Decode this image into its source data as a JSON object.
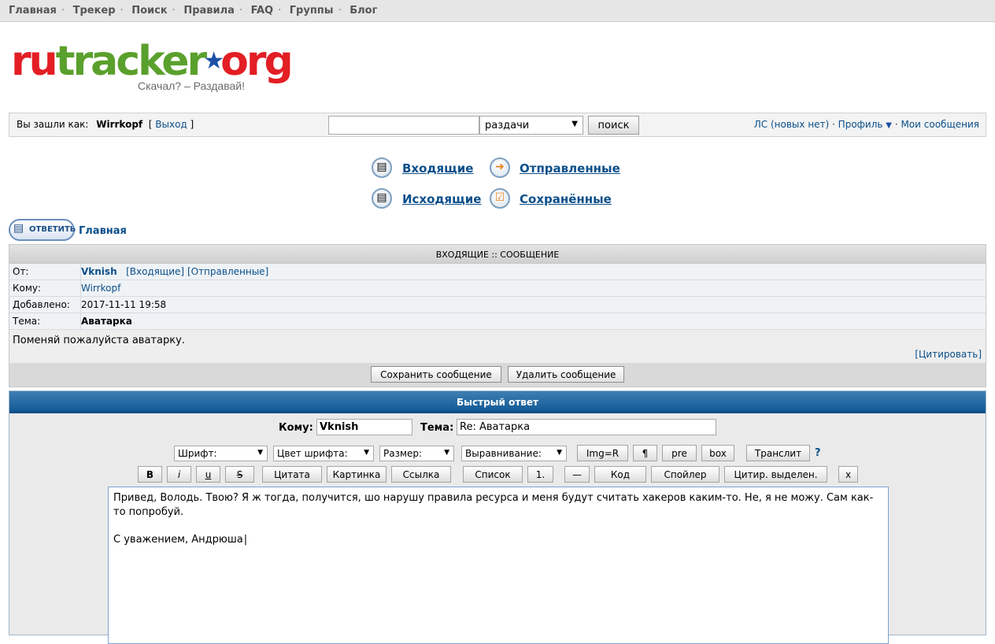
{
  "topnav": [
    "Главная",
    "Трекер",
    "Поиск",
    "Правила",
    "FAQ",
    "Группы",
    "Блог"
  ],
  "logo": {
    "ru": "ru",
    "tracker": "tracker",
    "org": "org",
    "slogan": "Скачал? – Раздавай!"
  },
  "userbar": {
    "logged_as": "Вы зашли как:",
    "username": "Wirrkopf",
    "logout": "Выход",
    "search_scope": "раздачи",
    "search_button": "поиск",
    "pm_link": "ЛС (новых нет)",
    "profile": "Профиль",
    "my_messages": "Мои сообщения"
  },
  "folders": {
    "inbox": "Входящие",
    "sent": "Отправленные",
    "outbox": "Исходящие",
    "saved": "Сохранённые"
  },
  "reply_button": "ОТВЕТИТЬ",
  "breadcrumb": "Главная",
  "message": {
    "header": "ВХОДЯЩИЕ :: СООБЩЕНИЕ",
    "from_label": "От:",
    "from_user": "Vknish",
    "from_inbox": "[Входящие]",
    "from_sent": "[Отправленные]",
    "to_label": "Кому:",
    "to_user": "Wirrkopf",
    "added_label": "Добавлено:",
    "added_value": "2017-11-11 19:58",
    "subject_label": "Тема:",
    "subject_value": "Аватарка",
    "body": "Поменяй пожалуйста аватарку.",
    "quote": "[Цитировать]",
    "save_button": "Сохранить сообщение",
    "delete_button": "Удалить сообщение"
  },
  "quick_reply": {
    "title": "Быстрый ответ",
    "to_label": "Кому:",
    "to_value": "Vknish",
    "subject_label": "Тема:",
    "subject_value": "Re: Аватарка",
    "font": "Шрифт:",
    "font_color": "Цвет шрифта:",
    "size": "Размер:",
    "align": "Выравнивание:",
    "btn_img": "Img=R",
    "btn_pilcrow": "¶",
    "btn_pre": "pre",
    "btn_box": "box",
    "btn_translit": "Транслит",
    "help": "?",
    "btn_b": "B",
    "btn_i": "i",
    "btn_u": "u",
    "btn_s": "S",
    "btn_quote": "Цитата",
    "btn_picture": "Картинка",
    "btn_link": "Ссылка",
    "btn_list": "Список",
    "btn_num": "1.",
    "btn_dash": "—",
    "btn_code": "Код",
    "btn_spoiler": "Спойлер",
    "btn_quote_sel": "Цитир. выделен.",
    "btn_close": "x",
    "text_line1": "Привед, Володь. Твою? Я ж тогда, получится, шо нарушу правила ресурса и меня будут считать хакеров каким-то. Не, я не можу. Сам как-то попробуй.",
    "text_line2": "С уважением, Андрюша"
  }
}
